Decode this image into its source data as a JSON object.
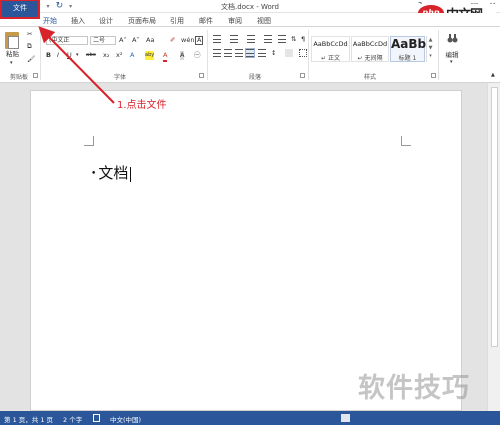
{
  "window": {
    "title": "文档.docx - Word",
    "controls": [
      "?",
      "▭",
      "—",
      "□",
      "✕"
    ]
  },
  "tabs": [
    {
      "label": "文件"
    },
    {
      "label": "开始"
    },
    {
      "label": "插入"
    },
    {
      "label": "设计"
    },
    {
      "label": "页面布局"
    },
    {
      "label": "引用"
    },
    {
      "label": "邮件"
    },
    {
      "label": "审阅"
    },
    {
      "label": "视图"
    }
  ],
  "ribbon": {
    "clipboard": {
      "label": "剪贴板",
      "paste_label": "粘贴"
    },
    "font": {
      "label": "字体",
      "font_name": "(中文正",
      "font_size": "二号",
      "glyphs": {
        "grow": "A˄",
        "shrink": "A˅",
        "case": "Aa",
        "clear": "✐",
        "phonetic": "wén",
        "border": "A",
        "bold": "B",
        "italic": "I",
        "underline": "U",
        "strike": "abc",
        "subscript": "x₂",
        "superscript": "x²",
        "effects": "A",
        "highlight": "aby",
        "color": "A",
        "shade": "A",
        "enclose": "㊀"
      }
    },
    "paragraph": {
      "label": "段落"
    },
    "styles": {
      "label": "样式",
      "items": [
        {
          "sample": "AaBbCcDd",
          "name": "↵ 正文"
        },
        {
          "sample": "AaBbCcDd",
          "name": "↵ 无间隔"
        },
        {
          "sample": "AaBb",
          "name": "标题 1"
        }
      ]
    },
    "editing": {
      "label": "编辑"
    }
  },
  "document": {
    "bullet": "•",
    "text": "文档"
  },
  "annotation": {
    "text": "1.点击文件",
    "color": "#d8232a"
  },
  "status": {
    "page": "第 1 页，共 1 页",
    "words": "2 个字",
    "language": "中文(中国)"
  },
  "logo": {
    "badge": "php",
    "name": "中文网"
  },
  "watermark": "软件技巧",
  "colors": {
    "accent": "#2b579a",
    "highlight": "#d8232a"
  }
}
